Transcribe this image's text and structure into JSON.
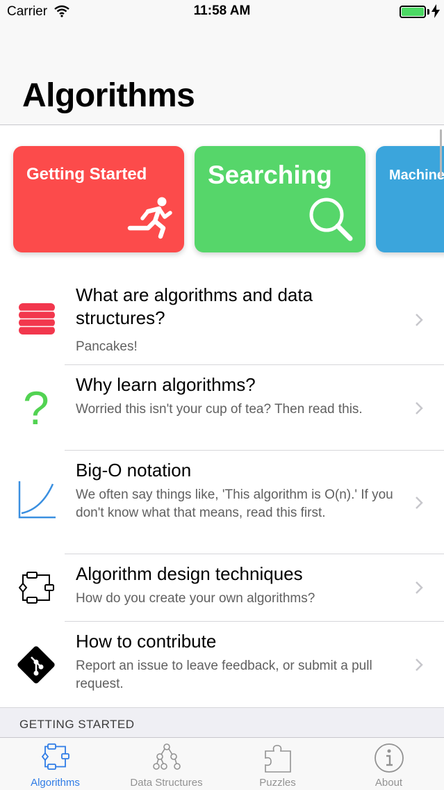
{
  "status_bar": {
    "carrier": "Carrier",
    "time": "11:58 AM"
  },
  "nav": {
    "title": "Algorithms"
  },
  "colors": {
    "card_red": "#fc4b4b",
    "card_green": "#56d66a",
    "card_blue": "#3ba5dc",
    "accent": "#2f7ce6",
    "db_red": "#f2374d",
    "question_green": "#52d352",
    "graph_blue": "#3a8fe0"
  },
  "cards": [
    {
      "title": "Getting Started",
      "icon": "running-person-icon"
    },
    {
      "title": "Searching",
      "icon": "magnifier-icon"
    },
    {
      "title": "Machine",
      "icon": ""
    }
  ],
  "rows": [
    {
      "title": "What are algorithms and data structures?",
      "subtitle": "Pancakes!",
      "icon": "database-icon"
    },
    {
      "title": "Why learn algorithms?",
      "subtitle": "Worried this isn't your cup of tea? Then read this.",
      "icon": "question-mark-icon"
    },
    {
      "title": "Big-O notation",
      "subtitle": "We often say things like, 'This algorithm is O(n).' If you don't know what that means, read this first.",
      "icon": "growth-graph-icon"
    },
    {
      "title": "Algorithm design techniques",
      "subtitle": "How do you create your own algorithms?",
      "icon": "flowchart-icon"
    },
    {
      "title": "How to contribute",
      "subtitle": "Report an issue to leave feedback, or submit a pull request.",
      "icon": "git-icon"
    }
  ],
  "section": {
    "label": "GETTING STARTED"
  },
  "tabs": [
    {
      "label": "Algorithms",
      "icon": "flowchart-icon",
      "active": true
    },
    {
      "label": "Data Structures",
      "icon": "tree-icon",
      "active": false
    },
    {
      "label": "Puzzles",
      "icon": "puzzle-icon",
      "active": false
    },
    {
      "label": "About",
      "icon": "info-icon",
      "active": false
    }
  ]
}
